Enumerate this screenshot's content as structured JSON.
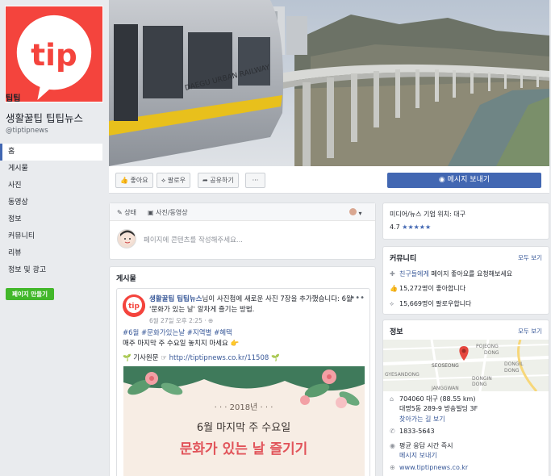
{
  "page": {
    "short_name": "팁팁",
    "name": "생활꿀팁 팁팁뉴스",
    "handle": "@tiptipnews",
    "logo_text": "tip"
  },
  "nav": [
    {
      "label": "홈"
    },
    {
      "label": "게시물"
    },
    {
      "label": "사진"
    },
    {
      "label": "동영상"
    },
    {
      "label": "정보"
    },
    {
      "label": "커뮤니티"
    },
    {
      "label": "리뷰"
    },
    {
      "label": "정보 및 광고"
    }
  ],
  "create_page_label": "페이지 만들기",
  "cover": {
    "train_text": "DAEGU URBAN RAILWAY"
  },
  "actions": {
    "like": "좋아요",
    "follow": "팔로우",
    "share": "공유하기",
    "more": "···",
    "message": "메시지 보내기"
  },
  "composer": {
    "tab_status": "상태",
    "tab_photo": "사진/동영상",
    "placeholder": "페이지에 콘텐츠를 작성해주세요..."
  },
  "posts": {
    "title": "게시물",
    "post": {
      "author": "생활꿀팁 팁팁뉴스",
      "header_rest": "님이 사진첩에 새로운 사진 7장을 추가했습니다: 6월 '문화가 있는 날' 알차게 즐기는 방법.",
      "time": "6월 27일 오후 2:25 · ⊕",
      "tags": "#6월 #문화가있는날 #지역별 #혜택",
      "text": "매주 마지막 주 수요일 놓치지 마세요 👉",
      "link_prefix": "🌱 기사원문 ☞",
      "link_url": "http://tiptipnews.co.kr/11508",
      "link_suffix": "🌱",
      "image": {
        "year": "· · · 2018년 · · ·",
        "subtitle": "6월 마지막 주 수요일",
        "headline": "문화가 있는 날 즐기기"
      }
    }
  },
  "side": {
    "category": "미디어/뉴스 기업 위치: 대구",
    "rating": "4.7",
    "stars": "★★★★★",
    "community": {
      "title": "커뮤니티",
      "more": "모두 보기",
      "invite_link": "친구들에게",
      "invite_rest": " 페이지 좋아요를 요청해보세요",
      "likes": "15,272명이 좋아합니다",
      "follows": "15,669명이 팔로우합니다"
    },
    "info": {
      "title": "정보",
      "more": "모두 보기",
      "address1": "704060 대구 (88.55 km)",
      "address2": "대명5동 289-9 방송빌딩 3F",
      "directions": "찾아가는 길 보기",
      "phone": "1833-5643",
      "response": "평균 응답 시간 즉시",
      "send_message": "메시지 보내기",
      "website": "www.tiptipnews.co.kr",
      "map_labels": [
        "POJEONG",
        "DONG",
        "DONGIL",
        "DONG",
        "SEOSEONG",
        "GYESANDONG",
        "DONGIN",
        "DONG",
        "JANGGWAN"
      ]
    }
  },
  "colors": {
    "brand": "#f4443d",
    "facebook_blue": "#4267b2",
    "link": "#385898",
    "green": "#42b72a"
  }
}
